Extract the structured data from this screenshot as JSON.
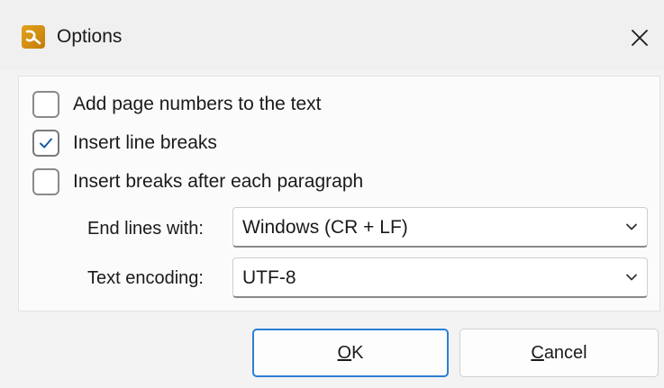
{
  "window": {
    "title": "Options",
    "close_icon": "close-icon",
    "app_icon": "pdf-editor-app-icon"
  },
  "options": [
    {
      "label": "Add page numbers to the text",
      "checked": false
    },
    {
      "label": "Insert line breaks",
      "checked": true
    },
    {
      "label": "Insert breaks after each paragraph",
      "checked": false
    }
  ],
  "fields": {
    "end_lines": {
      "label": "End lines with:",
      "value": "Windows (CR + LF)"
    },
    "text_encoding": {
      "label": "Text encoding:",
      "value": "UTF-8"
    }
  },
  "buttons": {
    "ok": {
      "label": "OK",
      "accel": "O"
    },
    "cancel": {
      "label": "Cancel",
      "accel": "C"
    }
  },
  "colors": {
    "accent": "#2a7fd4",
    "icon": "#e3a21a"
  }
}
